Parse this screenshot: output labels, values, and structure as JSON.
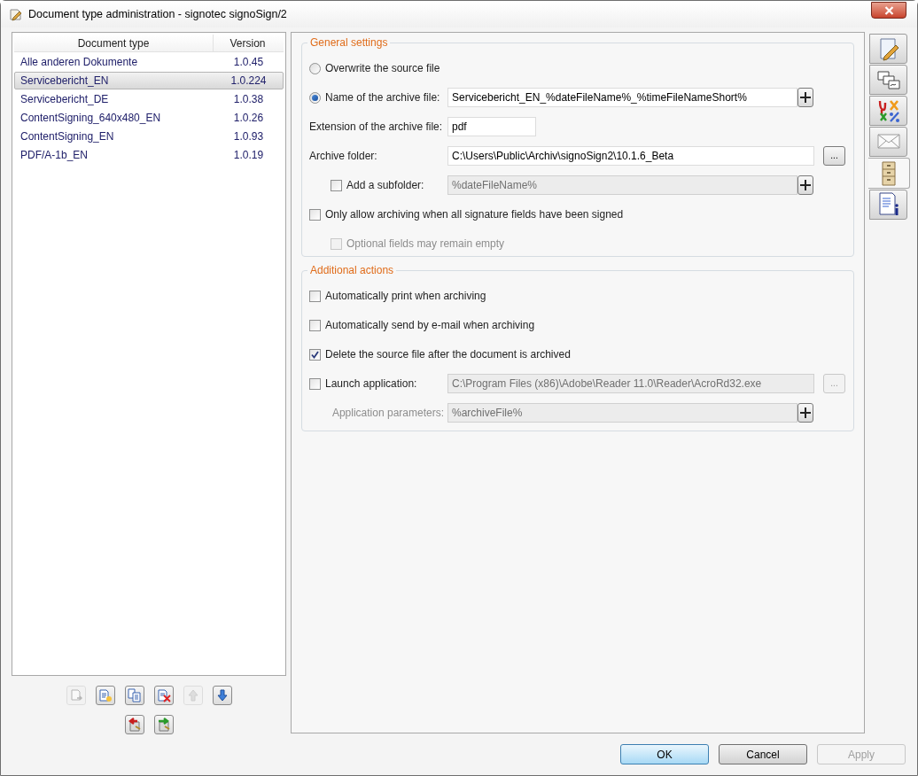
{
  "window": {
    "title": "Document type administration - signotec signoSign/2"
  },
  "document_list": {
    "columns": [
      "Document type",
      "Version"
    ],
    "rows": [
      {
        "name": "Alle anderen Dokumente",
        "version": "1.0.45",
        "selected": false
      },
      {
        "name": "Servicebericht_EN",
        "version": "1.0.224",
        "selected": true
      },
      {
        "name": "Servicebericht_DE",
        "version": "1.0.38",
        "selected": false
      },
      {
        "name": "ContentSigning_640x480_EN",
        "version": "1.0.26",
        "selected": false
      },
      {
        "name": "ContentSigning_EN",
        "version": "1.0.93",
        "selected": false
      },
      {
        "name": "PDF/A-1b_EN",
        "version": "1.0.19",
        "selected": false
      }
    ]
  },
  "list_toolbar": [
    [
      {
        "kind": "move",
        "disabled": true
      },
      {
        "kind": "new",
        "disabled": false
      },
      {
        "kind": "copy",
        "disabled": false
      },
      {
        "kind": "delete",
        "disabled": false
      },
      {
        "kind": "up",
        "disabled": true
      },
      {
        "kind": "down",
        "disabled": false
      }
    ],
    [
      {
        "kind": "import",
        "disabled": false
      },
      {
        "kind": "export",
        "disabled": false
      }
    ]
  ],
  "general_settings": {
    "title": "General settings",
    "rows": [
      {
        "kind": "radio",
        "label": "Overwrite the source file",
        "selected": false
      },
      {
        "kind": "radio",
        "label": "Name of the archive file:",
        "selected": true,
        "field": {
          "kind": "wide",
          "value": "Servicebericht_EN_%dateFileName%_%timeFileNameShort%",
          "disabled": false,
          "add_button": true
        }
      },
      {
        "kind": "label",
        "label": "Extension of the archive file:",
        "field": {
          "kind": "short",
          "value": "pdf",
          "disabled": false
        }
      },
      {
        "kind": "label",
        "label": "Archive folder:",
        "field": {
          "kind": "wide",
          "value": "C:\\Users\\Public\\Archiv\\signoSign2\\10.1.6_Beta",
          "disabled": false,
          "browse_button": {
            "label": "...",
            "disabled": false
          }
        },
        "children": [
          {
            "kind": "checkbox",
            "label": "Add a subfolder:",
            "checked": false,
            "field": {
              "kind": "wide",
              "value": "%dateFileName%",
              "disabled": true,
              "add_button": true
            }
          }
        ]
      },
      {
        "kind": "checkbox",
        "label": "Only allow archiving when all signature fields have been signed",
        "checked": false,
        "children": [
          {
            "kind": "checkbox",
            "label": "Optional fields may remain empty",
            "checked": false,
            "disabled": true
          }
        ]
      }
    ]
  },
  "additional_actions": {
    "title": "Additional actions",
    "rows": [
      {
        "kind": "checkbox",
        "label": "Automatically print when archiving",
        "checked": false
      },
      {
        "kind": "checkbox",
        "label": "Automatically send by e-mail when archiving",
        "checked": false
      },
      {
        "kind": "checkbox",
        "label": "Delete the source file after the document is archived",
        "checked": true
      },
      {
        "kind": "checkbox",
        "label": "Launch application:",
        "checked": false,
        "field": {
          "kind": "wide",
          "value": "C:\\Program Files (x86)\\Adobe\\Reader 11.0\\Reader\\AcroRd32.exe",
          "disabled": true,
          "browse_button": {
            "label": "...",
            "disabled": true
          }
        },
        "children": [
          {
            "kind": "label",
            "label": "Application parameters:",
            "disabled": true,
            "field": {
              "kind": "wide",
              "value": "%archiveFile%",
              "disabled": true,
              "add_button": true
            }
          }
        ]
      }
    ]
  },
  "side_tabs": [
    {
      "kind": "edit",
      "selected": false
    },
    {
      "kind": "cards",
      "selected": false
    },
    {
      "kind": "symbols",
      "selected": false
    },
    {
      "kind": "mail",
      "selected": false
    },
    {
      "kind": "cabinet",
      "selected": true
    },
    {
      "kind": "info",
      "selected": false
    }
  ],
  "buttons": [
    {
      "label": "OK",
      "kind": "default",
      "disabled": false
    },
    {
      "label": "Cancel",
      "kind": "normal",
      "disabled": false
    },
    {
      "label": "Apply",
      "kind": "normal",
      "disabled": true
    }
  ]
}
